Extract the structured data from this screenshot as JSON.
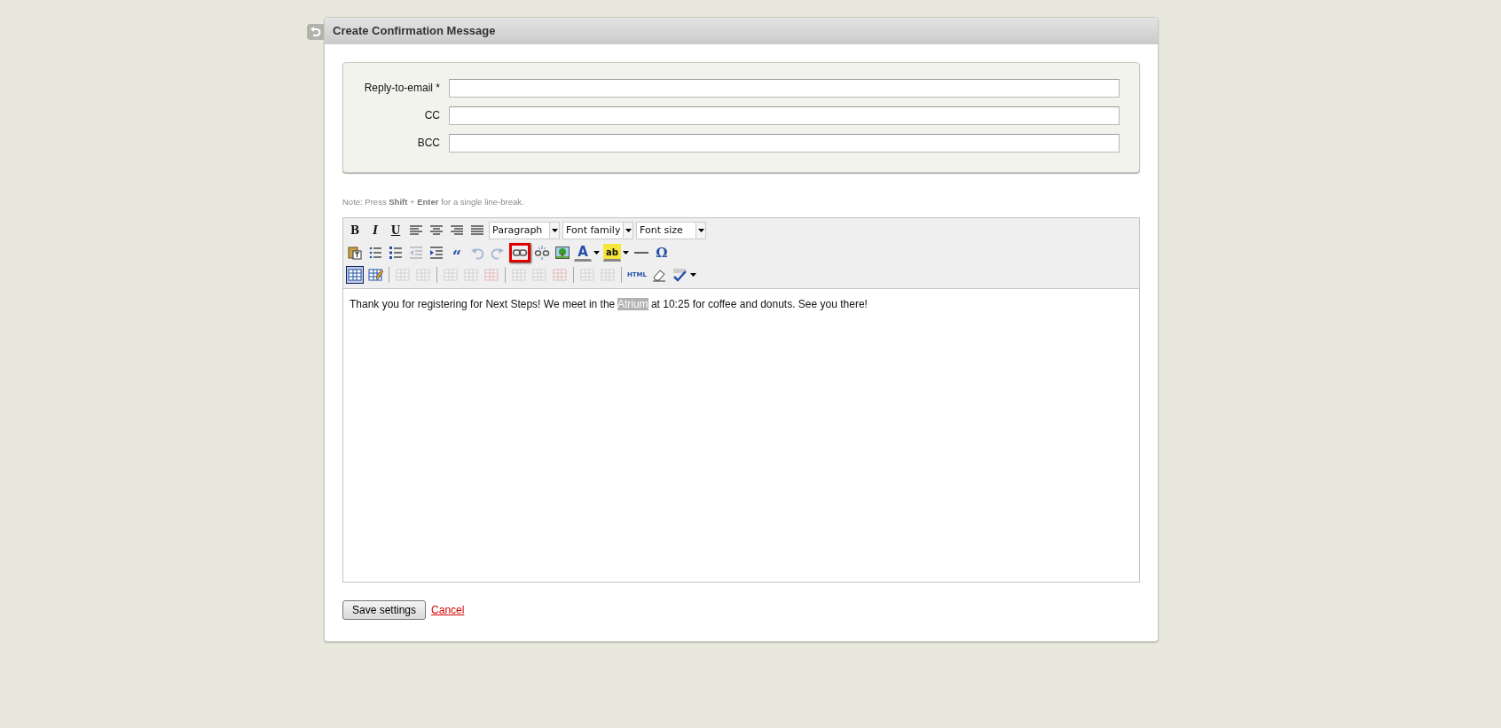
{
  "header": {
    "title": "Create Confirmation Message"
  },
  "fields": [
    {
      "label": "Reply-to-email *"
    },
    {
      "label": "CC"
    },
    {
      "label": "BCC"
    }
  ],
  "note": "Note: Press **Shift** + **Enter** for a single line-break.",
  "editor": {
    "toolbar": [
      [
        {
          "kind": "button",
          "label": "B",
          "disabled": false,
          "active": false,
          "highlighted": false
        },
        {
          "kind": "button",
          "label": "I",
          "disabled": false,
          "active": false,
          "highlighted": false
        },
        {
          "kind": "button",
          "label": "U",
          "disabled": false,
          "active": false,
          "highlighted": false
        },
        {
          "kind": "button",
          "disabled": false,
          "active": false,
          "highlighted": false
        },
        {
          "kind": "button",
          "disabled": false,
          "active": false,
          "highlighted": false
        },
        {
          "kind": "button",
          "disabled": false,
          "active": false,
          "highlighted": false
        },
        {
          "kind": "button",
          "disabled": false,
          "active": false,
          "highlighted": false
        },
        {
          "kind": "select",
          "value": "Paragraph"
        },
        {
          "kind": "select",
          "value": "Font family"
        },
        {
          "kind": "select",
          "value": "Font size"
        }
      ],
      [
        {
          "kind": "button",
          "disabled": false,
          "active": false,
          "highlighted": false
        },
        {
          "kind": "button",
          "disabled": false,
          "active": false,
          "highlighted": false
        },
        {
          "kind": "button",
          "disabled": false,
          "active": false,
          "highlighted": false
        },
        {
          "kind": "button",
          "disabled": true,
          "active": false,
          "highlighted": false
        },
        {
          "kind": "button",
          "disabled": false,
          "active": false,
          "highlighted": false
        },
        {
          "kind": "button",
          "label": "“",
          "disabled": false,
          "active": false,
          "highlighted": false
        },
        {
          "kind": "button",
          "disabled": true,
          "active": false,
          "highlighted": false
        },
        {
          "kind": "button",
          "disabled": true,
          "active": false,
          "highlighted": false
        },
        {
          "kind": "button",
          "disabled": false,
          "active": false,
          "highlighted": true
        },
        {
          "kind": "button",
          "disabled": false,
          "active": false,
          "highlighted": false
        },
        {
          "kind": "button",
          "disabled": false,
          "active": false,
          "highlighted": false
        },
        {
          "kind": "split",
          "label": "A",
          "disabled": false,
          "active": false,
          "highlighted": false
        },
        {
          "kind": "split",
          "label": "ab",
          "disabled": false,
          "active": false,
          "highlighted": false
        },
        {
          "kind": "button",
          "disabled": false,
          "active": false,
          "highlighted": false
        },
        {
          "kind": "button",
          "label": "Ω",
          "disabled": false,
          "active": false,
          "highlighted": false
        }
      ],
      [
        {
          "kind": "button",
          "disabled": false,
          "active": true,
          "highlighted": false
        },
        {
          "kind": "button",
          "disabled": false,
          "active": false,
          "highlighted": false
        },
        {
          "kind": "separator"
        },
        {
          "kind": "button",
          "disabled": true,
          "active": false,
          "highlighted": false
        },
        {
          "kind": "button",
          "disabled": true,
          "active": false,
          "highlighted": false
        },
        {
          "kind": "separator"
        },
        {
          "kind": "button",
          "disabled": true,
          "active": false,
          "highlighted": false
        },
        {
          "kind": "button",
          "disabled": true,
          "active": false,
          "highlighted": false
        },
        {
          "kind": "button",
          "disabled": true,
          "active": false,
          "highlighted": false
        },
        {
          "kind": "separator"
        },
        {
          "kind": "button",
          "disabled": true,
          "active": false,
          "highlighted": false
        },
        {
          "kind": "button",
          "disabled": true,
          "active": false,
          "highlighted": false
        },
        {
          "kind": "button",
          "disabled": true,
          "active": false,
          "highlighted": false
        },
        {
          "kind": "separator"
        },
        {
          "kind": "button",
          "disabled": true,
          "active": false,
          "highlighted": false
        },
        {
          "kind": "button",
          "disabled": true,
          "active": false,
          "highlighted": false
        },
        {
          "kind": "separator"
        },
        {
          "kind": "button",
          "label": "HTML",
          "disabled": false,
          "active": false,
          "highlighted": false
        },
        {
          "kind": "button",
          "disabled": false,
          "active": false,
          "highlighted": false
        },
        {
          "kind": "split",
          "disabled": false,
          "active": false,
          "highlighted": false
        }
      ]
    ],
    "content": [
      {
        "text": "Thank you for registering for Next Steps! We meet in the ",
        "selected": false
      },
      {
        "text": "Atrium",
        "selected": true
      },
      {
        "text": " at 10:25 for coffee and donuts. See you there!",
        "selected": false
      }
    ]
  },
  "actions": {
    "save": "Save settings",
    "cancel": "Cancel"
  }
}
